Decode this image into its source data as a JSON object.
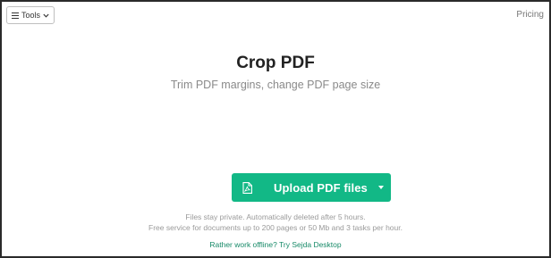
{
  "header": {
    "tools_label": "Tools",
    "pricing_label": "Pricing"
  },
  "hero": {
    "title": "Crop PDF",
    "subtitle": "Trim PDF margins, change PDF page size"
  },
  "upload": {
    "label": "Upload PDF files",
    "icon": "pdf-file-icon",
    "dropdown_icon": "caret-down-icon"
  },
  "notes": {
    "privacy": "Files stay private. Automatically deleted after 5 hours.",
    "limits": "Free service for documents up to 200 pages or 50 Mb and 3 tasks per hour."
  },
  "offline_link": "Rather work offline? Try Sejda Desktop",
  "colors": {
    "accent": "#12b886",
    "link": "#178a68",
    "title": "#222222",
    "muted": "#8a8a8a"
  }
}
